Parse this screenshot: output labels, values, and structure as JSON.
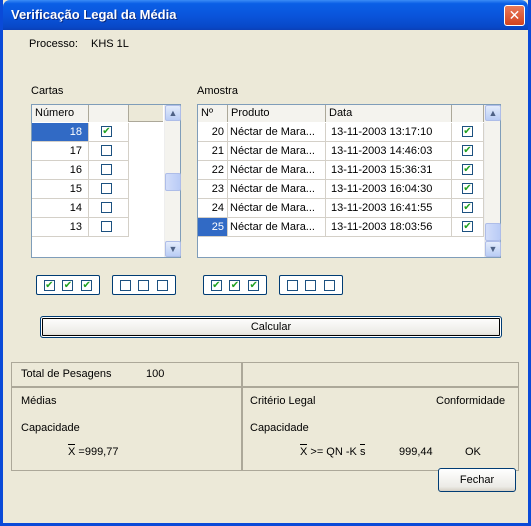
{
  "window": {
    "title": "Verificação Legal da Média",
    "close_glyph": "✕"
  },
  "processo": {
    "label": "Processo:",
    "value": "KHS 1L"
  },
  "cartas": {
    "label": "Cartas",
    "header": "Número",
    "rows": [
      {
        "numero": "18",
        "checked": true,
        "selected": true
      },
      {
        "numero": "17",
        "checked": false,
        "selected": false
      },
      {
        "numero": "16",
        "checked": false,
        "selected": false
      },
      {
        "numero": "15",
        "checked": false,
        "selected": false
      },
      {
        "numero": "14",
        "checked": false,
        "selected": false
      },
      {
        "numero": "13",
        "checked": false,
        "selected": false
      }
    ]
  },
  "amostra": {
    "label": "Amostra",
    "headers": [
      "Nº",
      "Produto",
      "Data"
    ],
    "rows": [
      {
        "n": "20",
        "produto": "Néctar de Mara...",
        "data": "13-11-2003 13:17:10",
        "checked": true,
        "selected": false
      },
      {
        "n": "21",
        "produto": "Néctar de Mara...",
        "data": "13-11-2003 14:46:03",
        "checked": true,
        "selected": false
      },
      {
        "n": "22",
        "produto": "Néctar de Mara...",
        "data": "13-11-2003 15:36:31",
        "checked": true,
        "selected": false
      },
      {
        "n": "23",
        "produto": "Néctar de Mara...",
        "data": "13-11-2003 16:04:30",
        "checked": true,
        "selected": false
      },
      {
        "n": "24",
        "produto": "Néctar de Mara...",
        "data": "13-11-2003 16:41:55",
        "checked": true,
        "selected": false
      },
      {
        "n": "25",
        "produto": "Néctar de Mara...",
        "data": "13-11-2003 18:03:56",
        "checked": true,
        "selected": true
      }
    ]
  },
  "buttons": {
    "calcular": "Calcular",
    "fechar": "Fechar"
  },
  "results": {
    "total_label": "Total de Pesagens",
    "total_value": "100",
    "medias": "Médias",
    "capacidade": "Capacidade",
    "media_symbol": "X",
    "media_value": "=999,77",
    "criterio": "Critério Legal",
    "conformidade": "Conformidade",
    "capacidade2": "Capacidade",
    "formula_x": "X",
    "formula_mid": ">= QN -K",
    "formula_s": "s",
    "criterio_value": "999,44",
    "status": "OK"
  },
  "colors": {
    "title_bar": "#0a55dc",
    "selection": "#316ac5",
    "window_bg": "#ece9d8"
  },
  "icons": {
    "close": "close-icon",
    "scroll_up": "chevron-up-icon",
    "scroll_down": "chevron-down-icon",
    "check": "checkmark-icon"
  }
}
